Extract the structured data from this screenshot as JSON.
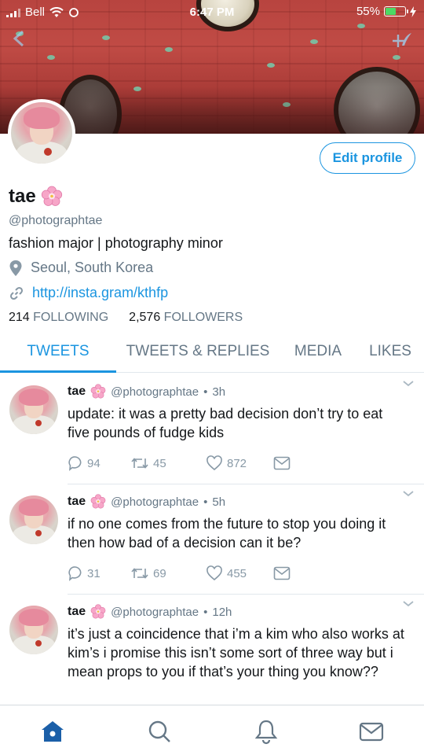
{
  "status_bar": {
    "carrier": "Bell",
    "time": "6:47 PM",
    "battery": "55%",
    "battery_level": 0.55
  },
  "profile": {
    "display_name": "tae",
    "handle": "@photographtae",
    "bio": "fashion major | photography minor",
    "location": "Seoul, South Korea",
    "url": "http://insta.gram/kthfp",
    "following_count": "214",
    "following_label": "FOLLOWING",
    "followers_count": "2,576",
    "followers_label": "FOLLOWERS",
    "edit_button": "Edit profile"
  },
  "tabs": [
    {
      "label": "TWEETS",
      "active": true
    },
    {
      "label": "TWEETS & REPLIES",
      "active": false
    },
    {
      "label": "MEDIA",
      "active": false
    },
    {
      "label": "LIKES",
      "active": false
    }
  ],
  "tweets": [
    {
      "name": "tae",
      "handle": "@photographtae",
      "time": "3h",
      "text": "update: it was a pretty bad decision don’t try to eat five pounds of fudge kids",
      "replies": "94",
      "retweets": "45",
      "likes": "872"
    },
    {
      "name": "tae",
      "handle": "@photographtae",
      "time": "5h",
      "text": "if no one comes from the future to stop you doing it then how bad of a decision can it be?",
      "replies": "31",
      "retweets": "69",
      "likes": "455"
    },
    {
      "name": "tae",
      "handle": "@photographtae",
      "time": "12h",
      "text": "it’s just a coincidence that i’m a kim who also works at kim’s i promise this isn’t some sort of three way but i mean props to you if that’s your thing you know??"
    }
  ],
  "bottom_nav": [
    "home-icon",
    "search-icon",
    "notifications-icon",
    "messages-icon"
  ],
  "colors": {
    "accent": "#1b95e0",
    "text": "#14171a",
    "muted": "#657786",
    "action": "#8899a6",
    "battery": "#4cd964"
  }
}
